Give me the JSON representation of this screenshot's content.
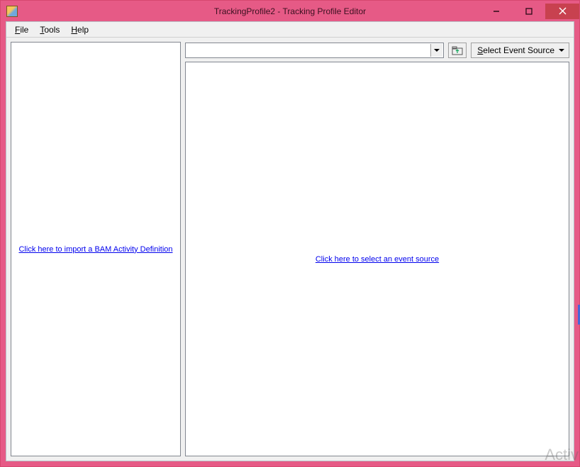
{
  "window": {
    "title": "TrackingProfile2 - Tracking Profile Editor"
  },
  "menubar": {
    "file": "File",
    "tools": "Tools",
    "help": "Help"
  },
  "toolbar": {
    "combo_value": "",
    "select_event_source_label": "Select Event Source"
  },
  "left_pane": {
    "import_link": "Click here to import a BAM Activity Definition"
  },
  "right_pane": {
    "select_source_link": "Click here to select an event source"
  },
  "watermark": {
    "line1": "Activ"
  }
}
